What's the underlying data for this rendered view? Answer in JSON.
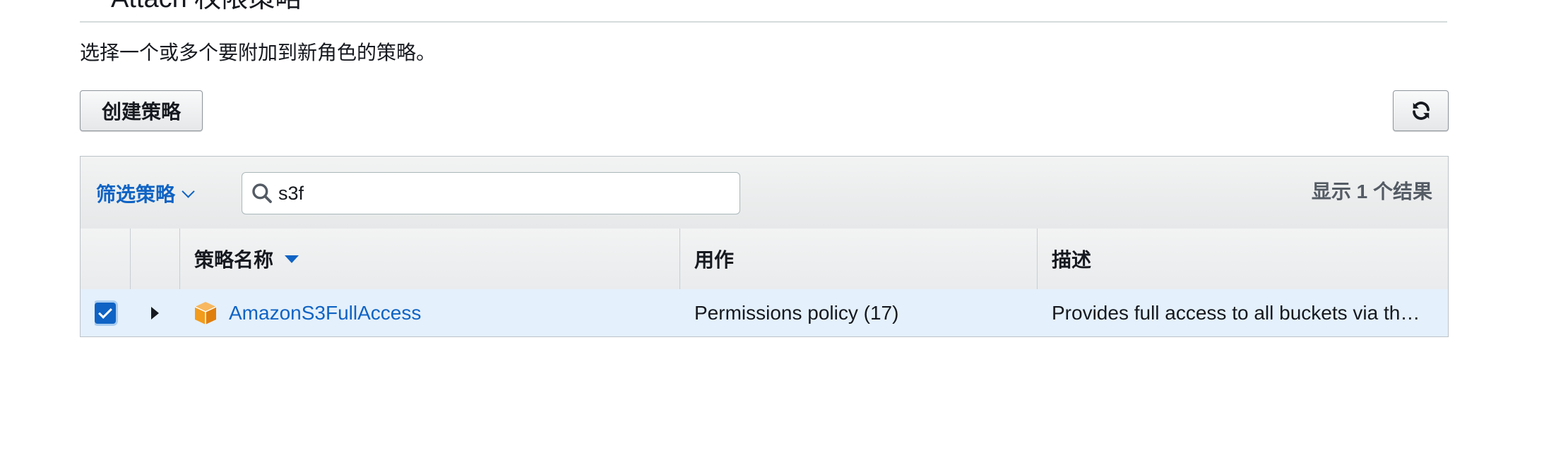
{
  "section": {
    "title": "Attach 权限策略"
  },
  "description": "选择一个或多个要附加到新角色的策略。",
  "toolbar": {
    "create_policy_label": "创建策略",
    "refresh_icon": "refresh-icon"
  },
  "filter": {
    "label": "筛选策略",
    "search_value": "s3f",
    "result_text": "显示 1 个结果"
  },
  "table": {
    "columns": [
      "策略名称",
      "用作",
      "描述"
    ],
    "sorted_column": "策略名称",
    "rows": [
      {
        "selected": true,
        "policy_name": "AmazonS3FullAccess",
        "used_as": "Permissions policy (17)",
        "description": "Provides full access to all buckets via th…",
        "icon": "aws-managed-policy-cube-icon"
      }
    ]
  },
  "colors": {
    "link": "#0f63c4",
    "row_selected_bg": "#e4f0fb",
    "policy_icon": "#f29b1c"
  }
}
